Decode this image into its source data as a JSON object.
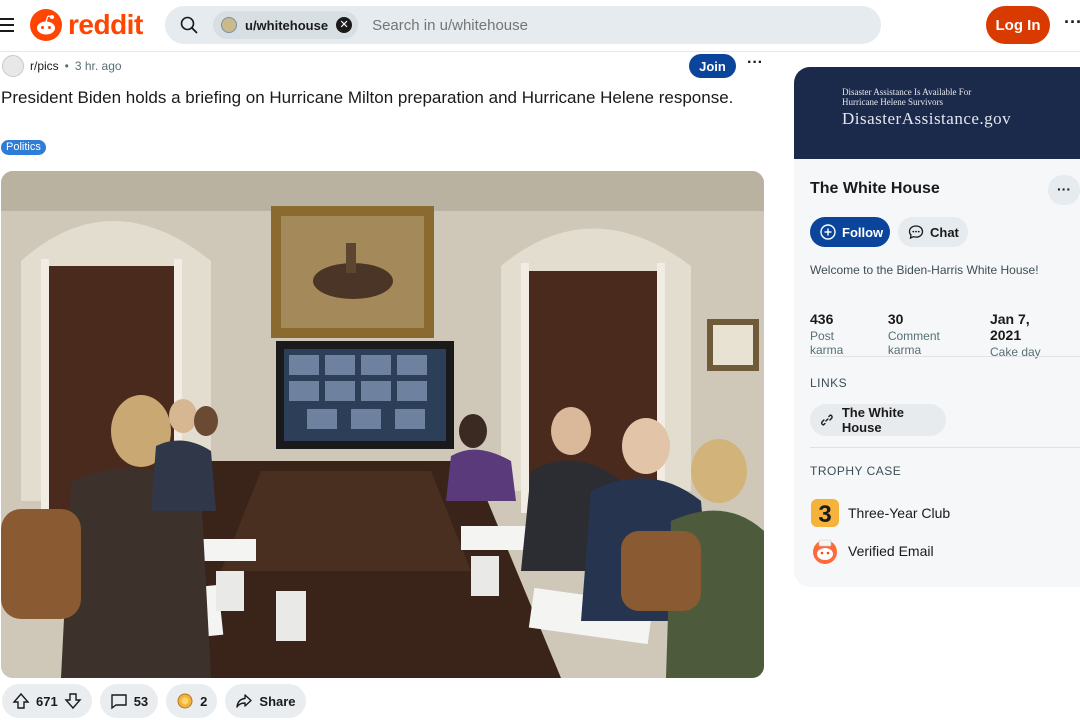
{
  "header": {
    "logo_text": "reddit",
    "search_chip": "u/whitehouse",
    "search_placeholder": "Search in u/whitehouse",
    "login_label": "Log In",
    "more_label": "···"
  },
  "post": {
    "subreddit": "r/pics",
    "time": "3 hr. ago",
    "join_label": "Join",
    "more_label": "···",
    "title": "President Biden holds a briefing on Hurricane Milton preparation and Hurricane Helene response.",
    "flair": "Politics",
    "image_alt": "Briefing in the White House Roosevelt Room with officials at a long table and a video conference screen",
    "actions": {
      "upvotes": "671",
      "comments": "53",
      "awards": "2",
      "share": "Share"
    }
  },
  "sidebar": {
    "banner_line1": "Disaster Assistance Is Available For",
    "banner_line2": "Hurricane Helene Survivors",
    "banner_site": "DisasterAssistance.gov",
    "name": "The White House",
    "more_label": "···",
    "follow_label": "Follow",
    "chat_label": "Chat",
    "welcome": "Welcome to the Biden-Harris White House!",
    "stats": [
      {
        "value": "436",
        "label": "Post karma"
      },
      {
        "value": "30",
        "label": "Comment karma"
      },
      {
        "value": "Jan 7, 2021",
        "label": "Cake day"
      }
    ],
    "links_heading": "LINKS",
    "link_label": "The White House",
    "trophy_heading": "TROPHY CASE",
    "trophies": [
      {
        "label": "Three-Year Club"
      },
      {
        "label": "Verified Email"
      }
    ]
  },
  "colors": {
    "brand": "#ff4500",
    "login": "#d93a00",
    "join": "#0a449b",
    "flair": "#2e7dd8",
    "banner": "#1b2a4a"
  }
}
